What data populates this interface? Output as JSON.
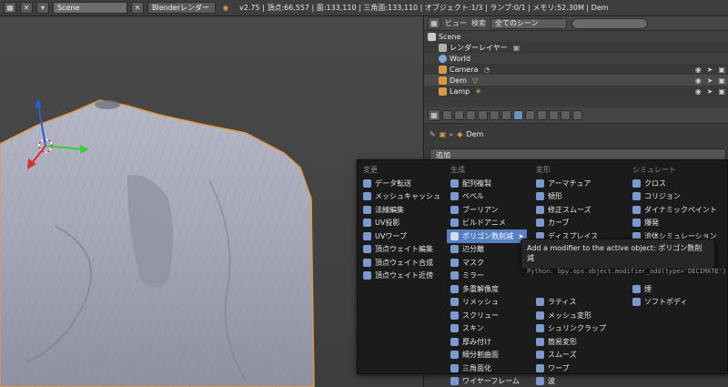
{
  "header": {
    "scene_name": "Scene",
    "render_engine": "Blenderレンダー",
    "stats": "v2.75 | 頂点:66,557 | 面:133,110 | 三角面:133,110 | オブジェクト:1/3 | ランプ:0/1 | メモリ:52.30M | Dem"
  },
  "outliner": {
    "view_label": "ビュー",
    "search_label": "検索",
    "scene_filter": "全てのシーン",
    "items": [
      {
        "label": "Scene"
      },
      {
        "label": "レンダーレイヤー"
      },
      {
        "label": "World"
      },
      {
        "label": "Camera"
      },
      {
        "label": "Dem"
      },
      {
        "label": "Lamp"
      }
    ]
  },
  "properties": {
    "breadcrumb_object": "Dem",
    "add_modifier_label": "追加"
  },
  "menu": {
    "columns": [
      {
        "header": "変更",
        "items": [
          "データ転送",
          "メッシュキャッシュ",
          "法線編集",
          "UV投影",
          "UVワープ",
          "頂点ウェイト編集",
          "頂点ウェイト合成",
          "頂点ウェイト近傍"
        ]
      },
      {
        "header": "生成",
        "items": [
          "配列複製",
          "ベベル",
          "ブーリアン",
          "ビルドアニメ",
          "ポリゴン数削減",
          "辺分離",
          "マスク",
          "ミラー",
          "多重解像度",
          "リメッシュ",
          "スクリュー",
          "スキン",
          "厚み付け",
          "細分割曲面",
          "三角面化",
          "ワイヤーフレーム"
        ]
      },
      {
        "header": "変形",
        "items": [
          "アーマチュア",
          "傾形",
          "修正スムーズ",
          "カーブ",
          "ディスプレイス",
          "",
          "",
          "",
          "",
          "ラティス",
          "メッシュ変形",
          "シュリンクラップ",
          "簡易変形",
          "スムーズ",
          "ワープ",
          "波"
        ]
      },
      {
        "header": "シミュレート",
        "items": [
          "クロス",
          "コリジョン",
          "ダイナミックペイント",
          "爆発",
          "流体シミュレーション",
          "",
          "",
          "",
          "煙",
          "ソフトボディ"
        ]
      }
    ],
    "highlighted": "ポリゴン数削減"
  },
  "tooltip": {
    "title": "Add a modifier to the active object:  ポリゴン数削減",
    "code": "Python: bpy.ops.object.modifier_add(type='DECIMATE')"
  },
  "colors": {
    "menu_highlight": "#5680c2",
    "selection_outline": "#e79a3b"
  }
}
